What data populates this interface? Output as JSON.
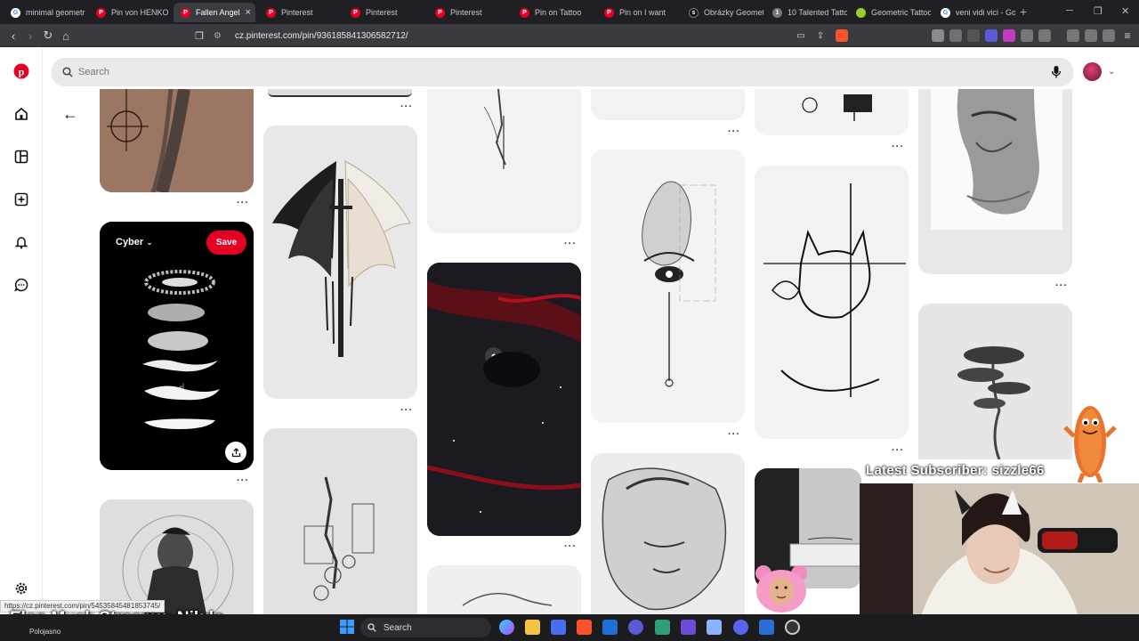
{
  "browser": {
    "tabs": [
      {
        "label": "minimal geometr",
        "color": "#34a853",
        "icon": "google-icon"
      },
      {
        "label": "Pin von HENKO a",
        "color": "#e60023",
        "icon": "pinterest-icon"
      },
      {
        "label": "Fallen Angel",
        "color": "#e60023",
        "icon": "pinterest-icon",
        "active": true
      },
      {
        "label": "Pinterest",
        "color": "#e60023",
        "icon": "pinterest-icon"
      },
      {
        "label": "Pinterest",
        "color": "#e60023",
        "icon": "pinterest-icon"
      },
      {
        "label": "Pinterest",
        "color": "#e60023",
        "icon": "pinterest-icon"
      },
      {
        "label": "Pin on Tattoo",
        "color": "#e60023",
        "icon": "pinterest-icon"
      },
      {
        "label": "Pin on I want",
        "color": "#e60023",
        "icon": "pinterest-icon"
      },
      {
        "label": "Obrázky Geomet",
        "color": "#111111",
        "icon": "shutterstock-icon"
      },
      {
        "label": "10 Talented Tatto",
        "color": "#777777",
        "icon": "site-icon"
      },
      {
        "label": "Geometric Tattoo",
        "color": "#9acd32",
        "icon": "leaf-icon"
      },
      {
        "label": "veni vidi vici - Go",
        "color": "#34a853",
        "icon": "google-icon"
      }
    ],
    "close_glyph": "×",
    "new_tab_glyph": "+",
    "url": "cz.pinterest.com/pin/936185841306582712/"
  },
  "pinterest": {
    "search_placeholder": "Search",
    "board_name": "Cyber",
    "save_label": "Save",
    "more_dots": "···"
  },
  "status_url": "https://cz.pinterest.com/pin/545358454818537​45/",
  "overlay": {
    "latest_subscriber": "Latest Subscriber: sizzle66",
    "stream_title": "Elon Musk Streamu: Nikdo"
  },
  "taskbar": {
    "weather": "Polojasno",
    "search_label": "Search"
  }
}
